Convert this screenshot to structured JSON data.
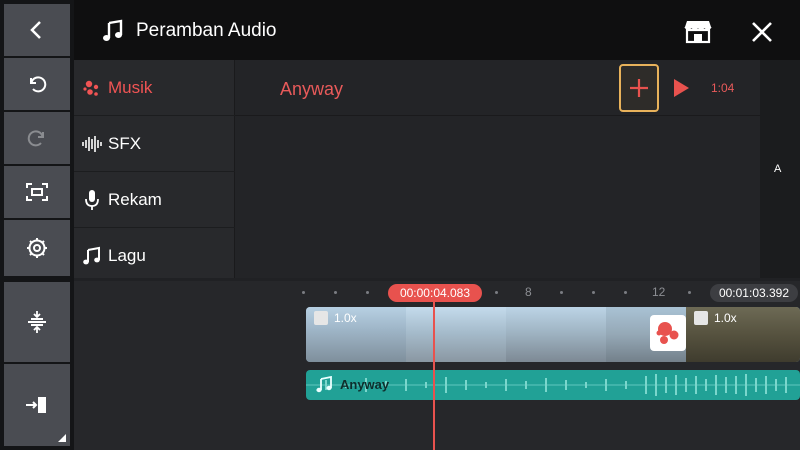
{
  "header": {
    "title": "Peramban Audio"
  },
  "categories": [
    {
      "label": "Musik",
      "icon": "music-bubbles-icon",
      "active": true
    },
    {
      "label": "SFX",
      "icon": "waveform-icon",
      "active": false
    },
    {
      "label": "Rekam",
      "icon": "microphone-icon",
      "active": false
    },
    {
      "label": "Lagu",
      "icon": "music-note-icon",
      "active": false
    }
  ],
  "track": {
    "name": "Anyway",
    "duration": "1:04"
  },
  "index_letter": "A",
  "timeline": {
    "current_time": "00:00:04.083",
    "total_time": "00:01:03.392",
    "ruler_labels": [
      "8",
      "12"
    ],
    "video_clip": {
      "speed_left": "1.0x",
      "speed_right": "1.0x"
    },
    "audio_clip": {
      "name": "Anyway"
    }
  },
  "colors": {
    "accent": "#e8524e",
    "audio_track": "#21a196",
    "add_highlight": "#e8b25b"
  }
}
